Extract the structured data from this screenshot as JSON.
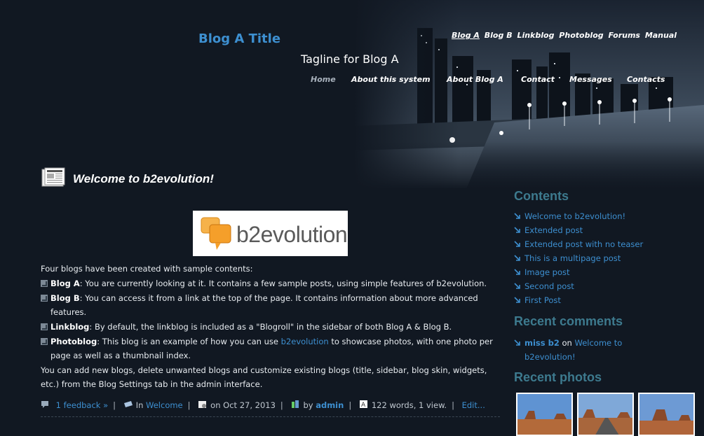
{
  "header": {
    "blog_title": "Blog A Title",
    "tagline": "Tagline for Blog A",
    "blog_links": [
      "Blog A",
      "Blog B",
      "Linkblog",
      "Photoblog",
      "Forums",
      "Manual"
    ],
    "menu": [
      "Home",
      "About this system",
      "About Blog A",
      "Contact",
      "Messages",
      "Contacts"
    ]
  },
  "post": {
    "title": "Welcome to b2evolution!",
    "logo_text": "b2evolution",
    "intro": "Four blogs have been created with sample contents:",
    "items": [
      {
        "name": "Blog A",
        "text": ": You are currently looking at it. It contains a few sample posts, using simple features of b2evolution."
      },
      {
        "name": "Blog B",
        "text": ": You can access it from a link at the top of the page. It contains information about more advanced features."
      },
      {
        "name": "Linkblog",
        "text": ": By default, the linkblog is included as a \"Blogroll\" in the sidebar of both Blog A & Blog B."
      },
      {
        "name": "Photoblog",
        "text_before": ": This blog is an example of how you can use ",
        "link": "b2evolution",
        "text_after": " to showcase photos, with one photo per page as well as a thumbnail index."
      }
    ],
    "outro": "You can add new blogs, delete unwanted blogs and customize existing blogs (title, sidebar, blog skin, widgets, etc.) from the Blog Settings tab in the admin interface.",
    "footer": {
      "feedback": "1 feedback »",
      "in_label": "In",
      "category": "Welcome",
      "date": "on Oct 27, 2013",
      "by_label": "by",
      "author": "admin",
      "stats": "122 words, 1 view.",
      "edit": "Edit..."
    }
  },
  "sidebar": {
    "contents_title": "Contents",
    "contents": [
      "Welcome to b2evolution!",
      "Extended post",
      "Extended post with no teaser",
      "This is a multipage post",
      "Image post",
      "Second post",
      "First Post"
    ],
    "comments_title": "Recent comments",
    "comment": {
      "author": "miss b2",
      "on": "on",
      "post": "Welcome to b2evolution!"
    },
    "photos_title": "Recent photos"
  },
  "colors": {
    "accent": "#3d8fd0",
    "sidebar_heading": "#3d7a8e",
    "background": "#111822"
  }
}
